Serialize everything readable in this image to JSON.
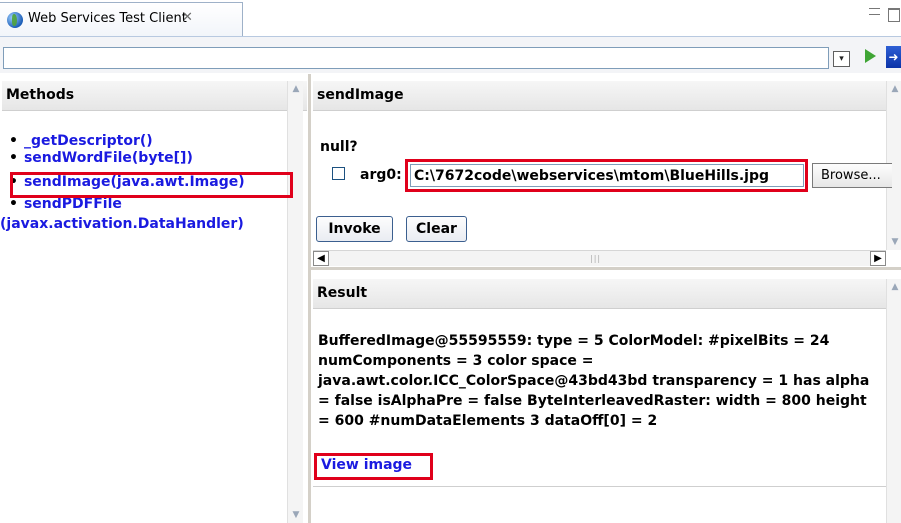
{
  "tab": {
    "title": "Web Services Test Client",
    "close_glyph": "✕",
    "icon": "web-services-globe-icon"
  },
  "address": {
    "value": "",
    "dropdown_glyph": "▾",
    "go_icon": "play-triangle-icon",
    "bookmark_icon": "arrow-bookmark-icon"
  },
  "methods": {
    "header": "Methods",
    "items": [
      {
        "label": "_getDescriptor()"
      },
      {
        "label": "sendWordFile(byte[])"
      },
      {
        "label": "sendImage(java.awt.Image)"
      },
      {
        "label": "sendPDFFile"
      },
      {
        "label": "(javax.activation.DataHandler)"
      }
    ]
  },
  "send_image": {
    "header": "sendImage",
    "null_label": "null?",
    "arg_label": "arg0:",
    "arg_value": "C:\\7672code\\webservices\\mtom\\BlueHills.jpg",
    "browse_label": "Browse...",
    "invoke_label": "Invoke",
    "clear_label": "Clear"
  },
  "result": {
    "header": "Result",
    "text": "BufferedImage@55595559: type = 5 ColorModel: #pixelBits = 24 numComponents = 3 color space = java.awt.color.ICC_ColorSpace@43bd43bd transparency = 1 has alpha = false isAlphaPre = false ByteInterleavedRaster: width = 800 height = 600 #numDataElements 3 dataOff[0] = 2",
    "link_label": "View image"
  },
  "colors": {
    "highlight": "#e0001b",
    "link": "#1a1ae0",
    "header_bg": "#e9e9e9"
  }
}
